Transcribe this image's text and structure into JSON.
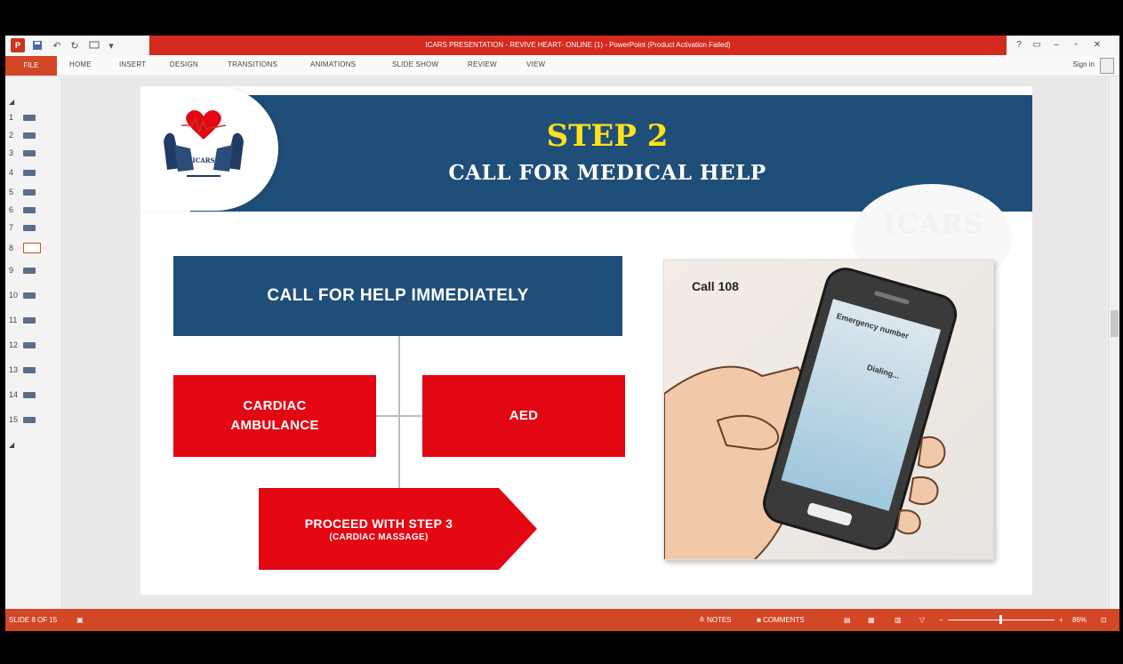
{
  "window": {
    "title": "ICARS PRESENTATION - REVIVE HEART- ONLINE (1) - PowerPoint (Product Activation Failed)",
    "help": "?",
    "minimize": "–",
    "restore": "▫",
    "close": "✕"
  },
  "ribbon": {
    "file": "FILE",
    "tabs": [
      "HOME",
      "INSERT",
      "DESIGN",
      "TRANSITIONS",
      "ANIMATIONS",
      "SLIDE SHOW",
      "REVIEW",
      "VIEW"
    ],
    "sign_in": "Sign in"
  },
  "thumbnails": {
    "items": [
      "1",
      "2",
      "3",
      "4",
      "5",
      "6",
      "7",
      "8",
      "9",
      "10",
      "11",
      "12",
      "13",
      "14",
      "15"
    ],
    "active_index": 7
  },
  "slide": {
    "step_title": "STEP 2",
    "step_subtitle": "CALL FOR MEDICAL HELP",
    "watermark": "ICARS",
    "logo_text": "ICARS",
    "call_box": "CALL FOR HELP IMMEDIATELY",
    "ambulance_box": "CARDIAC\nAMBULANCE",
    "aed_box": "AED",
    "proceed_line1": "PROCEED WITH STEP 3",
    "proceed_line2": "(CARDIAC MASSAGE)",
    "image_label": "Call 108",
    "phone_screen_line1": "Emergency number",
    "phone_screen_line2": "Dialing..."
  },
  "statusbar": {
    "slide_count": "SLIDE 8 OF 15",
    "notes": "NOTES",
    "comments": "COMMENTS",
    "zoom": "86%"
  },
  "colors": {
    "brand_red": "#d24726",
    "header_blue": "#1f4e79",
    "box_red": "#e30613",
    "title_yellow": "#ffe11a"
  }
}
